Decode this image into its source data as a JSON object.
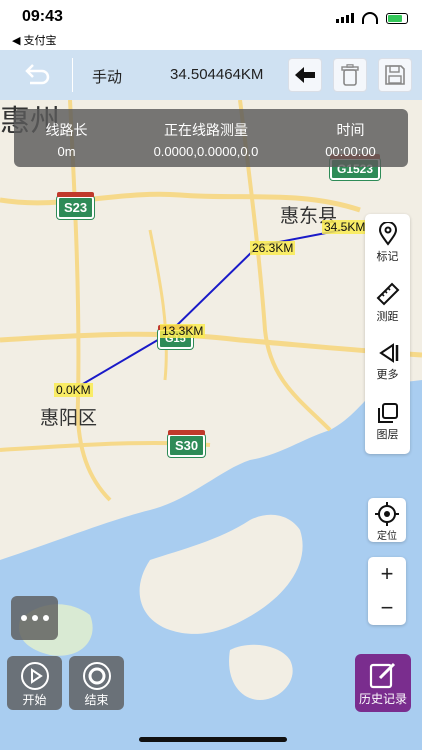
{
  "status_bar": {
    "time": "09:43",
    "back_app": "◀ 支付宝"
  },
  "toolbar": {
    "mode": "手动",
    "distance": "34.504464KM"
  },
  "info_panel": {
    "columns": [
      {
        "header": "线路长",
        "value": "0m"
      },
      {
        "header": "正在线路测量",
        "value": "0.0000,0.0000,0.0"
      },
      {
        "header": "时间",
        "value": "00:00:00"
      }
    ]
  },
  "map": {
    "places": [
      {
        "name": "惠州"
      },
      {
        "name": "惠东县"
      },
      {
        "name": "惠阳区"
      }
    ],
    "roads": [
      "S23",
      "G15",
      "S30",
      "G1523"
    ],
    "distance_labels": [
      "0.0KM",
      "13.3KM",
      "26.3KM",
      "34.5KM"
    ]
  },
  "right_tools": {
    "mark": "标记",
    "measure": "测距",
    "more": "更多",
    "layers": "图层"
  },
  "locate": "定位",
  "zoom": {
    "in": "+",
    "out": "−"
  },
  "bottom": {
    "start": "开始",
    "end": "结束",
    "history": "历史记录"
  },
  "colors": {
    "route": "#1a1ac8",
    "toolbar": "#cfe1f2",
    "history": "#7a2d8e",
    "shield": "#2e8b57"
  }
}
